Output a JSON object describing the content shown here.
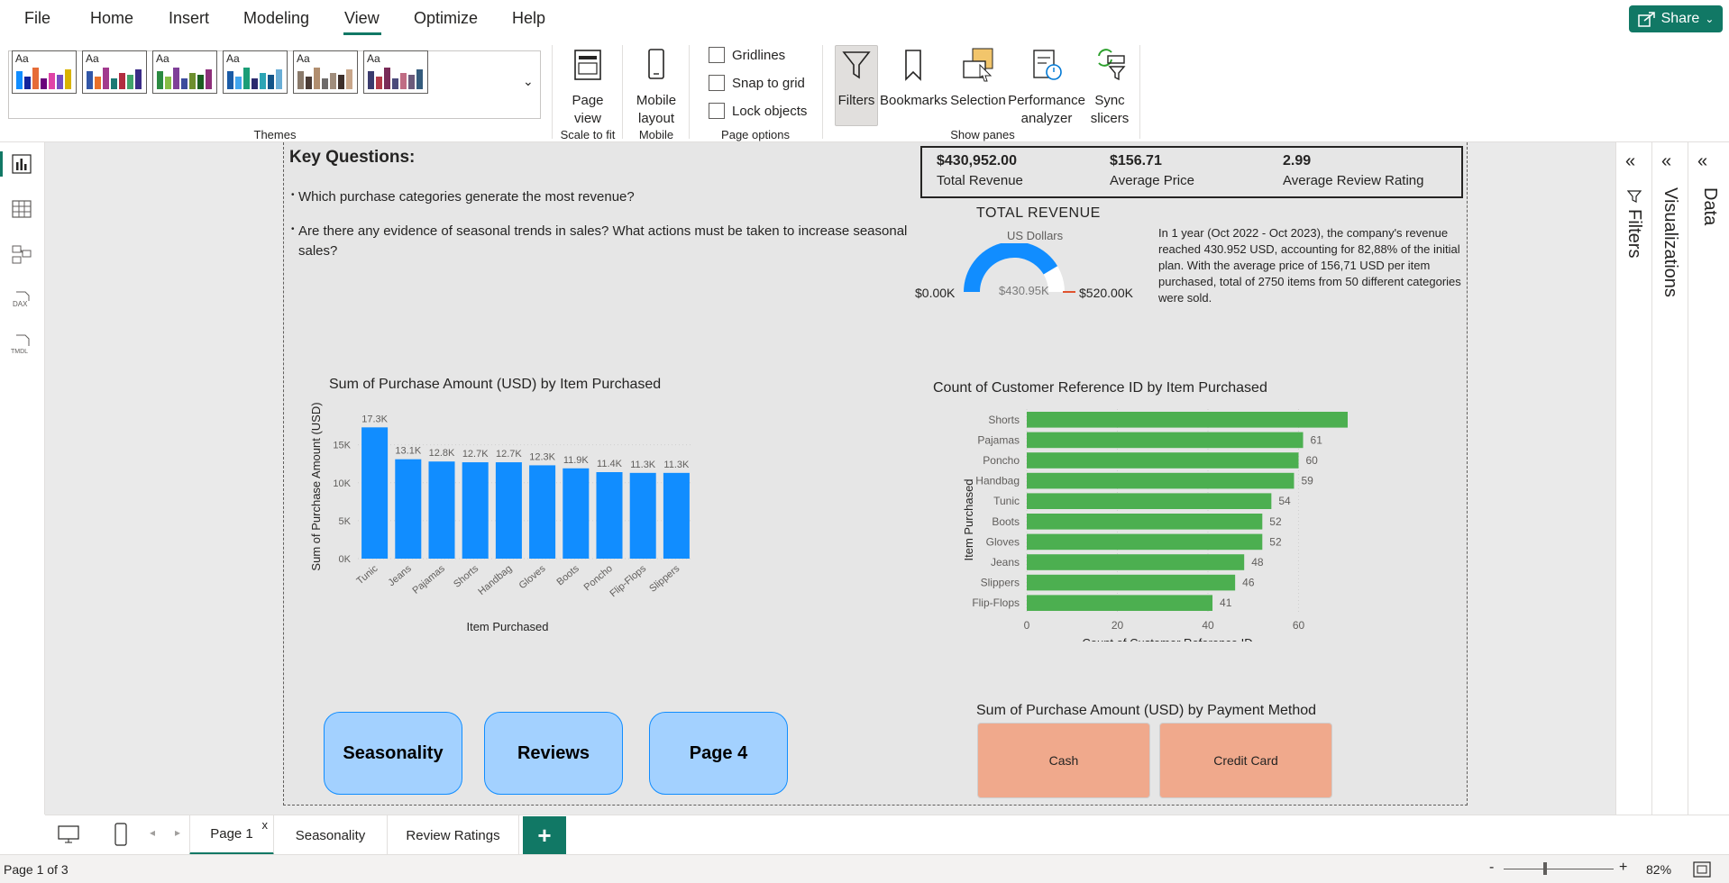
{
  "menu": {
    "items": [
      "File",
      "Home",
      "Insert",
      "Modeling",
      "View",
      "Optimize",
      "Help"
    ],
    "active": "View",
    "share_label": "Share"
  },
  "ribbon": {
    "themes_label": "Themes",
    "theme_aa": "Aa",
    "themes": [
      [
        "#118dff",
        "#12239e",
        "#e66c37",
        "#6b007b",
        "#e044a7",
        "#744ec2",
        "#d9b300"
      ],
      [
        "#3257a8",
        "#e8702a",
        "#a2398e",
        "#1d7874",
        "#b22d40",
        "#40a36b",
        "#3b2c87"
      ],
      [
        "#2a8a41",
        "#86bd44",
        "#7f3f98",
        "#3c4b9c",
        "#6d8f2e",
        "#1b5e20",
        "#8e2f7a"
      ],
      [
        "#1a5ba6",
        "#41a5ee",
        "#1b9e77",
        "#2a2a6e",
        "#2ca5b5",
        "#125488",
        "#6aaed6"
      ],
      [
        "#8a7a6b",
        "#4a3b35",
        "#b18e6f",
        "#6e6b6a",
        "#a08d7c",
        "#3d2f2a",
        "#c9a78b"
      ],
      [
        "#3b3b6d",
        "#b23a48",
        "#7a2c58",
        "#4b4a7b",
        "#c06c84",
        "#6c5b7b",
        "#355c7d"
      ]
    ],
    "page_view_label": "Page view",
    "scale_label": "Scale to fit",
    "mobile_layout_label": "Mobile layout",
    "mobile_group_label": "Mobile",
    "options": [
      "Gridlines",
      "Snap to grid",
      "Lock objects"
    ],
    "page_options_label": "Page options",
    "panes": [
      "Filters",
      "Bookmarks",
      "Selection",
      "Performance analyzer",
      "Sync slicers"
    ],
    "show_panes_label": "Show panes"
  },
  "panes": {
    "filters": "Filters",
    "visualizations": "Visualizations",
    "data": "Data"
  },
  "report": {
    "key_questions_title": "Key Questions:",
    "questions": [
      "Which purchase categories generate the most revenue?",
      "Are there any evidence of seasonal trends in sales? What actions must be taken to increase seasonal sales?"
    ],
    "kpis": [
      {
        "value": "$430,952.00",
        "label": "Total Revenue"
      },
      {
        "value": "$156.71",
        "label": "Average Price"
      },
      {
        "value": "2.99",
        "label": "Average Review Rating"
      }
    ],
    "gauge": {
      "title": "TOTAL REVENUE",
      "subtitle": "US Dollars",
      "min_label": "$0.00K",
      "max_label": "$520.00K",
      "value_label": "$430.95K",
      "value": 430.95,
      "max": 520
    },
    "note": "In 1 year (Oct 2022 - Oct 2023), the company's revenue reached 430.952 USD, accounting for 82,88% of the initial plan. With the average price of 156,71 USD per item purchased, total of 2750 items from 50 different categories were sold.",
    "nav_buttons": [
      "Seasonality",
      "Reviews",
      "Page 4"
    ],
    "payment_title": "Sum of Purchase Amount (USD) by Payment Method",
    "payment_methods": [
      "Cash",
      "Credit Card"
    ]
  },
  "chart_data": [
    {
      "type": "bar",
      "title": "Sum of Purchase Amount (USD) by Item Purchased",
      "xlabel": "Item Purchased",
      "ylabel": "Sum of Purchase Amount (USD)",
      "categories": [
        "Tunic",
        "Jeans",
        "Pajamas",
        "Shorts",
        "Handbag",
        "Gloves",
        "Boots",
        "Poncho",
        "Flip-Flops",
        "Slippers"
      ],
      "values": [
        17300,
        13100,
        12800,
        12700,
        12700,
        12300,
        11900,
        11400,
        11300,
        11300
      ],
      "data_labels": [
        "17.3K",
        "13.1K",
        "12.8K",
        "12.7K",
        "12.7K",
        "12.3K",
        "11.9K",
        "11.4K",
        "11.3K",
        "11.3K"
      ],
      "yticks": [
        "0K",
        "5K",
        "10K",
        "15K"
      ],
      "ylim": [
        0,
        19000
      ],
      "color": "#118dff"
    },
    {
      "type": "bar",
      "orientation": "horizontal",
      "title": "Count of Customer Reference ID by Item Purchased",
      "xlabel": "Count of Customer Reference ID",
      "ylabel": "Item Purchased",
      "categories": [
        "Shorts",
        "Pajamas",
        "Poncho",
        "Handbag",
        "Tunic",
        "Boots",
        "Gloves",
        "Jeans",
        "Slippers",
        "Flip-Flops"
      ],
      "values": [
        74,
        61,
        60,
        59,
        54,
        52,
        52,
        48,
        46,
        41
      ],
      "xticks": [
        "0",
        "20",
        "40",
        "60"
      ],
      "xlim": [
        0,
        80
      ],
      "color": "#4caf50"
    }
  ],
  "tabs": {
    "pages": [
      "Page 1",
      "Seasonality",
      "Review Ratings"
    ],
    "active": "Page 1",
    "close": "x",
    "add": "+"
  },
  "status": {
    "page_info": "Page 1 of 3",
    "zoom": "82%",
    "minus": "-",
    "plus": "+"
  }
}
